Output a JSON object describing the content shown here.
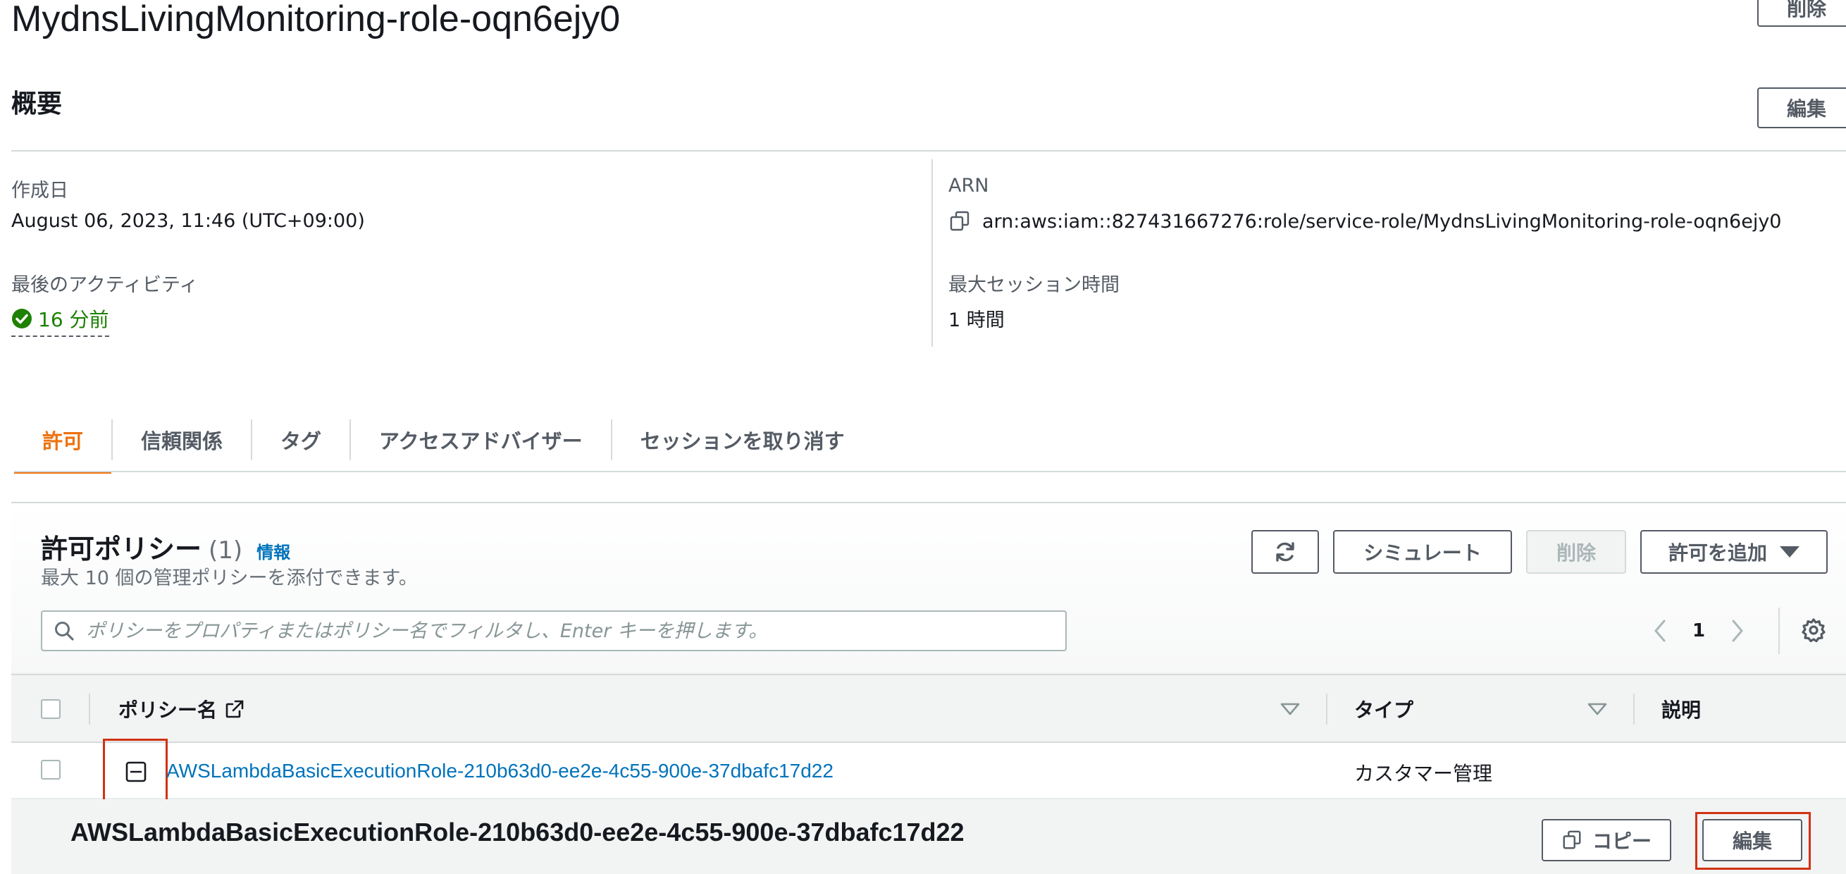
{
  "role": {
    "name": "MydnsLivingMonitoring-role-oqn6ejy0",
    "delete_label": "削除"
  },
  "overview": {
    "title": "概要",
    "edit_label": "編集",
    "created_label": "作成日",
    "created_value": "August 06, 2023, 11:46 (UTC+09:00)",
    "last_activity_label": "最後のアクティビティ",
    "last_activity_value": "16 分前",
    "arn_label": "ARN",
    "arn_value": "arn:aws:iam::827431667276:role/service-role/MydnsLivingMonitoring-role-oqn6ejy0",
    "max_session_label": "最大セッション時間",
    "max_session_value": "1 時間"
  },
  "tabs": [
    {
      "label": "許可",
      "active": true
    },
    {
      "label": "信頼関係"
    },
    {
      "label": "タグ"
    },
    {
      "label": "アクセスアドバイザー"
    },
    {
      "label": "セッションを取り消す"
    }
  ],
  "policies": {
    "title": "許可ポリシー",
    "count": "(1)",
    "info_label": "情報",
    "description": "最大 10 個の管理ポリシーを添付できます。",
    "simulate_label": "シミュレート",
    "delete_label": "削除",
    "add_label": "許可を追加",
    "search_placeholder": "ポリシーをプロパティまたはポリシー名でフィルタし、Enter キーを押します。",
    "page": "1",
    "columns": {
      "name": "ポリシー名",
      "type": "タイプ",
      "description": "説明"
    },
    "rows": [
      {
        "name": "AWSLambdaBasicExecutionRole-210b63d0-ee2e-4c55-900e-37dbafc17d22",
        "type": "カスタマー管理",
        "description": ""
      }
    ],
    "expanded": {
      "title": "AWSLambdaBasicExecutionRole-210b63d0-ee2e-4c55-900e-37dbafc17d22",
      "copy_label": "コピー",
      "edit_label": "編集"
    }
  },
  "colors": {
    "accent": "#ec7211",
    "link": "#0073bb",
    "success": "#1d8102",
    "highlight": "#d13212"
  }
}
